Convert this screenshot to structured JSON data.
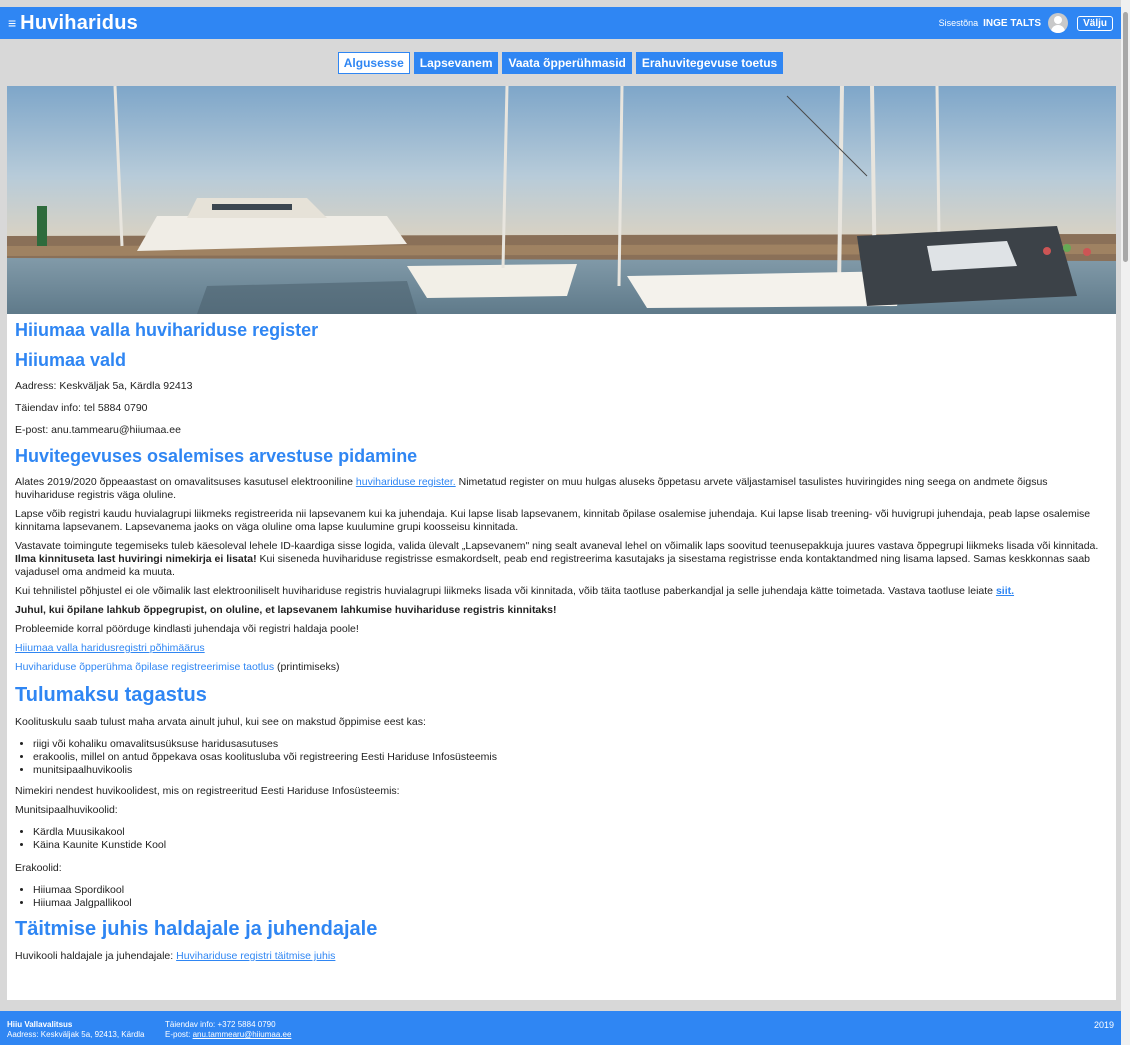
{
  "header": {
    "brand": "Huviharidus",
    "signed_in_label": "Sisestõna",
    "user_name": "INGE TALTS",
    "logout": "Välju"
  },
  "nav": {
    "tabs": [
      {
        "label": "Algusesse"
      },
      {
        "label": "Lapsevanem"
      },
      {
        "label": "Vaata õpperühmasid"
      },
      {
        "label": "Erahuvitegevuse toetus"
      }
    ]
  },
  "content": {
    "title": "Hiiumaa valla huvihariduse register",
    "municipality": "Hiiumaa vald",
    "address": "Aadress: Keskväljak 5a, Kärdla 92413",
    "extra_info": "Täiendav info: tel 5884 0790",
    "email": "E-post: anu.tammearu@hiiumaa.ee",
    "section1_title": "Huvitegevuses osalemises arvestuse pidamine",
    "p1_before": "Alates 2019/2020 õppeaastast on omavalitsuses kasutusel elektrooniline ",
    "p1_link": "huvihariduse register.",
    "p1_after": " Nimetatud register on muu hulgas aluseks õppetasu arvete väljastamisel tasulistes huviringides ning seega on andmete õigsus huvihariduse registris väga oluline.",
    "p2": "Lapse võib registri kaudu huvialagrupi liikmeks registreerida nii lapsevanem kui ka juhendaja. Kui lapse lisab lapsevanem, kinnitab õpilase osalemise juhendaja. Kui lapse lisab treening- või huvigrupi juhendaja, peab lapse osalemise kinnitama lapsevanem. Lapsevanema jaoks on väga oluline oma lapse kuulumine grupi koosseisu kinnitada.",
    "p3_before": "Vastavate toimingute tegemiseks tuleb käesoleval lehele ID-kaardiga sisse logida, valida ülevalt „Lapsevanem\" ning sealt avaneval lehel on võimalik laps soovitud teenusepakkuja juures vastava õppegrupi liikmeks lisada või kinnitada. ",
    "p3_bold": "Ilma kinnituseta last huviringi nimekirja ei lisata!",
    "p3_after": " Kui siseneda huvihariduse registrisse esmakordselt, peab end registreerima kasutajaks ja sisestama registrisse enda kontaktandmed ning lisama lapsed. Samas keskkonnas saab vajadusel oma andmeid ka muuta.",
    "p4_before": "Kui tehnilistel põhjustel ei ole võimalik last elektrooniliselt huvihariduse registris huvialagrupi liikmeks lisada või kinnitada, võib täita taotluse paberkandjal ja selle juhendaja kätte toimetada. Vastava taotluse leiate ",
    "p4_link": "siit.",
    "p5_bold": "Juhul, kui õpilane lahkub õppegrupist, on oluline, et lapsevanem lahkumise huvihariduse registris kinnitaks!",
    "p6": "Probleemide korral pöörduge kindlasti juhendaja või registri haldaja poole!",
    "link1": "Hiiumaa valla haridusregistri põhimäärus",
    "link2": "Huvihariduse õpperühma õpilase registreerimise taotlus",
    "link2_suffix": " (printimiseks)",
    "section2_title": "Tulumaksu tagastus",
    "tax_intro": "Koolituskulu saab tulust maha arvata ainult juhul, kui see on makstud õppimise eest kas:",
    "tax_items": [
      "riigi või kohaliku omavalitsusüksuse haridusasutuses",
      "erakoolis, millel on antud õppekava osas koolitusluba või registreering Eesti Hariduse Infosüsteemis",
      "munitsipaalhuvikoolis"
    ],
    "list_intro": "Nimekiri nendest huvikoolidest, mis on registreeritud Eesti Hariduse Infosüsteemis:",
    "muni_label": "Munitsipaalhuvikoolid:",
    "muni_items": [
      "Kärdla Muusikakool",
      "Käina Kaunite Kunstide Kool"
    ],
    "private_label": "Erakoolid:",
    "private_items": [
      "Hiiumaa Spordikool",
      "Hiiumaa Jalgpallikool"
    ],
    "section3_title": "Täitmise juhis haldajale ja juhendajale",
    "guide_before": "Huvikooli haldajale ja juhendajale: ",
    "guide_link": "Huvihariduse registri täitmise juhis"
  },
  "footer": {
    "org": "Hiiu Vallavalitsus",
    "address": "Aadress: Keskväljak 5a, 92413, Kärdla",
    "info": "Täiendav info: +372 5884 0790",
    "email_label": "E-post: ",
    "email": "anu.tammearu@hiiumaa.ee",
    "year": "2019"
  },
  "colors": {
    "accent": "#2f86f3",
    "page_bg": "#d8d8d8"
  }
}
